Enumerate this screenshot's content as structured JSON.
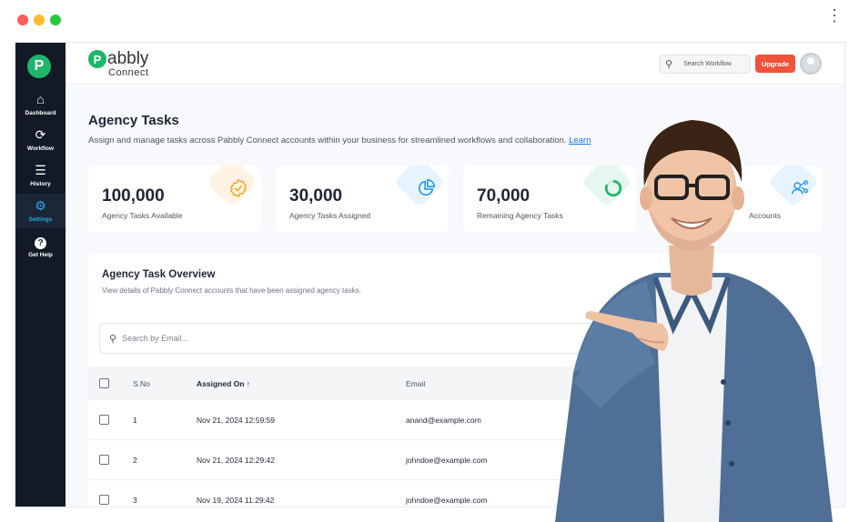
{
  "window": {
    "controls": {
      "close_color": "#ff5f57",
      "minimize_color": "#febc2e",
      "maximize_color": "#28c840"
    }
  },
  "sidebar": {
    "logo": "P",
    "items": [
      {
        "label": "Dashboard",
        "icon": "home-icon",
        "glyph": "⌂"
      },
      {
        "label": "Workflow",
        "icon": "workflow-icon",
        "glyph": "⟳"
      },
      {
        "label": "History",
        "icon": "history-icon",
        "glyph": "☰"
      },
      {
        "label": "Settings",
        "icon": "gear-icon",
        "glyph": "⚙",
        "active": true
      },
      {
        "label": "Get Help",
        "icon": "help-icon",
        "glyph": "?"
      }
    ]
  },
  "header": {
    "brand_mark": "P",
    "brand_name": "abbly",
    "brand_sub": "Connect",
    "search_placeholder": "Search Workflow",
    "upgrade_label": "Upgrade"
  },
  "page": {
    "title": "Agency Tasks",
    "description": "Assign and manage tasks across Pabbly Connect accounts within your business for streamlined workflows and collaboration.",
    "learn_link": "Learn"
  },
  "stats": [
    {
      "value": "100,000",
      "label": "Agency Tasks Available",
      "icon": "badge-check-icon",
      "color": "#f6a623"
    },
    {
      "value": "30,000",
      "label": "Agency Tasks Assigned",
      "icon": "pie-chart-icon",
      "color": "#2196f3"
    },
    {
      "value": "70,000",
      "label": "Remaining Agency Tasks",
      "icon": "progress-ring-icon",
      "color": "#1fb66b"
    },
    {
      "value": "",
      "label": "Accounts",
      "icon": "users-share-icon",
      "color": "#2196f3"
    }
  ],
  "overview": {
    "title": "Agency Task Overview",
    "subtitle": "View details of Pabbly Connect accounts that have been assigned agency tasks.",
    "search_placeholder": "Search by Email...",
    "columns": {
      "sno": "S.No",
      "assigned_on": "Assigned On ↑",
      "email": "Email"
    },
    "rows": [
      {
        "sno": "1",
        "assigned_on": "Nov 21, 2024 12:59:59",
        "email": "anand@example.com"
      },
      {
        "sno": "2",
        "assigned_on": "Nov 21, 2024 12:29:42",
        "email": "johndoe@example.com"
      },
      {
        "sno": "3",
        "assigned_on": "Nov 19, 2024 11:29:42",
        "email": "johndoe@example.com"
      }
    ]
  }
}
